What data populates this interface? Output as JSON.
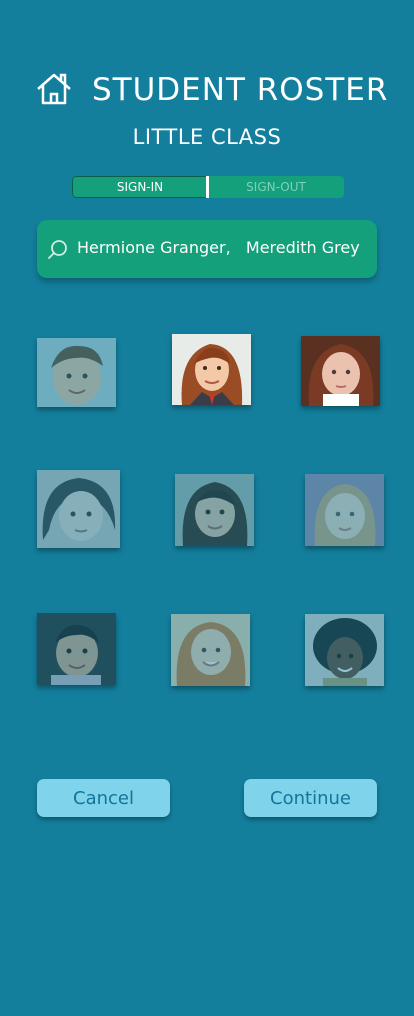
{
  "header": {
    "title": "STUDENT ROSTER",
    "home_icon": "home-icon",
    "subtitle": "LITTLE CLASS"
  },
  "toggle": {
    "options": [
      {
        "label": "SIGN-IN",
        "active": true
      },
      {
        "label": "SIGN-OUT",
        "active": false
      }
    ]
  },
  "search": {
    "icon": "search-icon",
    "value": "Hermione Granger,   Meredith Grey"
  },
  "students": [
    {
      "selected": false
    },
    {
      "selected": true
    },
    {
      "selected": true
    },
    {
      "selected": false
    },
    {
      "selected": false
    },
    {
      "selected": false
    },
    {
      "selected": false
    },
    {
      "selected": false
    },
    {
      "selected": false
    }
  ],
  "actions": {
    "cancel_label": "Cancel",
    "continue_label": "Continue"
  },
  "colors": {
    "background": "#137f9d",
    "accent_green": "#13a07a",
    "button": "#7fd3ea",
    "button_text": "#14759a"
  }
}
